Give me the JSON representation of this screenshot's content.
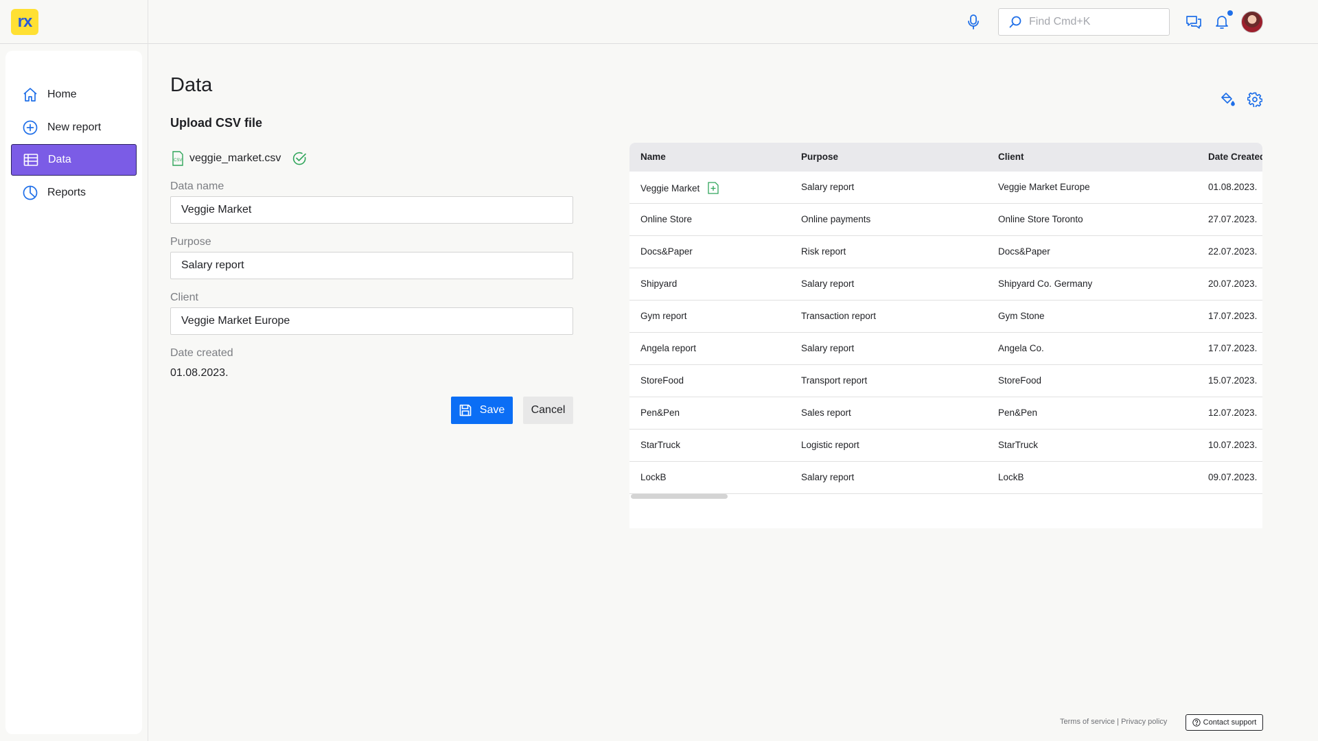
{
  "app": {
    "logo_text": "rx"
  },
  "header": {
    "search_placeholder": "Find Cmd+K",
    "icons": [
      "microphone-icon",
      "search-icon",
      "chat-icon",
      "bell-icon"
    ],
    "accent": "#1f6fe8"
  },
  "sidebar": {
    "items": [
      {
        "label": "Home",
        "icon": "home-icon"
      },
      {
        "label": "New report",
        "icon": "plus-circle-icon"
      },
      {
        "label": "Data",
        "icon": "data-table-icon",
        "active": true
      },
      {
        "label": "Reports",
        "icon": "pie-chart-icon"
      }
    ],
    "active_color": "#7b5ce6"
  },
  "main": {
    "title": "Data",
    "upload_title": "Upload CSV file",
    "file": {
      "name": "veggie_market.csv",
      "status": "uploaded"
    },
    "form": {
      "data_name_label": "Data name",
      "data_name_value": "Veggie Market",
      "purpose_label": "Purpose",
      "purpose_value": "Salary report",
      "client_label": "Client",
      "client_value": "Veggie Market Europe",
      "date_label": "Date created",
      "date_value": "01.08.2023."
    },
    "buttons": {
      "save": "Save",
      "cancel": "Cancel"
    },
    "primary_color": "#0b6ef5"
  },
  "table": {
    "columns": [
      "Name",
      "Purpose",
      "Client",
      "Date Created"
    ],
    "rows": [
      [
        "Veggie Market",
        "Salary report",
        "Veggie Market Europe",
        "01.08.2023."
      ],
      [
        "Online Store",
        "Online payments",
        "Online Store Toronto",
        "27.07.2023."
      ],
      [
        "Docs&Paper",
        "Risk report",
        "Docs&Paper",
        "22.07.2023."
      ],
      [
        "Shipyard",
        "Salary report",
        "Shipyard Co. Germany",
        "20.07.2023."
      ],
      [
        "Gym report",
        "Transaction report",
        "Gym Stone",
        "17.07.2023."
      ],
      [
        "Angela report",
        "Salary report",
        "Angela Co.",
        "17.07.2023."
      ],
      [
        "StoreFood",
        "Transport report",
        "StoreFood",
        "15.07.2023."
      ],
      [
        "Pen&Pen",
        "Sales report",
        "Pen&Pen",
        "12.07.2023."
      ],
      [
        "StarTruck",
        "Logistic report",
        "StarTruck",
        "10.07.2023."
      ],
      [
        "LockB",
        "Salary report",
        "LockB",
        "09.07.2023."
      ]
    ]
  },
  "footer": {
    "terms": "Terms of service",
    "separator": " | ",
    "privacy": "Privacy policy",
    "support": "Contact support"
  }
}
